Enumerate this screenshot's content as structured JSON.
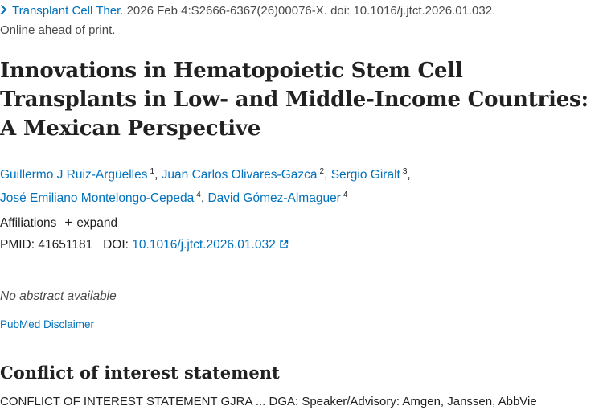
{
  "citation": {
    "journal": "Transplant Cell Ther.",
    "details": " 2026 Feb 4:S2666-6367(26)00076-X. doi: 10.1016/j.jtct.2026.01.032.",
    "status": "Online ahead of print."
  },
  "title": "Innovations in Hematopoietic Stem Cell Transplants in Low- and Middle-Income Countries: A Mexican Perspective",
  "authors": [
    {
      "name": "Guillermo J Ruiz-Argüelles",
      "aff": "1"
    },
    {
      "name": "Juan Carlos Olivares-Gazca",
      "aff": "2"
    },
    {
      "name": "Sergio Giralt",
      "aff": "3"
    },
    {
      "name": "José Emiliano Montelongo-Cepeda",
      "aff": "4"
    },
    {
      "name": "David Gómez-Almaguer",
      "aff": "4"
    }
  ],
  "separators": {
    "comma": ","
  },
  "affiliations": {
    "label": "Affiliations",
    "expand_icon": "plus-icon",
    "expand_label": "expand"
  },
  "identifiers": {
    "pmid_label": "PMID:",
    "pmid": "41651181",
    "doi_label": "DOI:",
    "doi": "10.1016/j.jtct.2026.01.032",
    "doi_icon": "external-link-icon"
  },
  "abstract": {
    "text": "No abstract available"
  },
  "disclaimer": {
    "link": "PubMed Disclaimer"
  },
  "conflict": {
    "heading": "Conflict of interest statement",
    "text": "CONFLICT OF INTEREST STATEMENT GJRA ... DGA: Speaker/Advisory: Amgen, Janssen, AbbVie"
  },
  "colors": {
    "link": "#0071bc",
    "text": "#212121",
    "muted": "#4a4a4a"
  }
}
